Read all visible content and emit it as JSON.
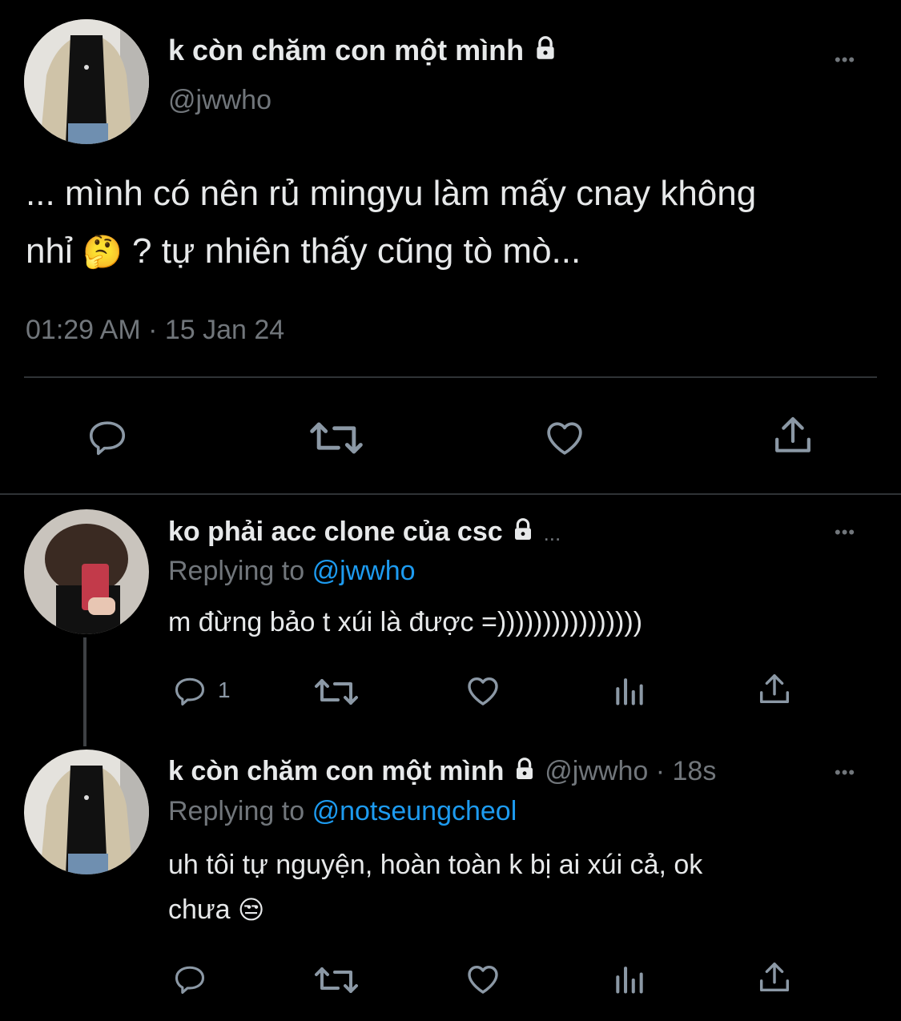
{
  "main_tweet": {
    "display_name": "k còn chăm con một mình",
    "handle": "@jwwho",
    "text_line1": "... mình có nên rủ mingyu làm mấy cnay không",
    "text_line2_a": "nhỉ",
    "text_line2_emoji": "🤔",
    "text_line2_b": "? tự nhiên thấy cũng tò mò...",
    "timestamp": "01:29 AM · 15 Jan 24",
    "icons": [
      "reply-icon",
      "retweet-icon",
      "like-icon",
      "share-icon"
    ]
  },
  "reply1": {
    "display_name": "ko phải acc clone của csc",
    "name_ellipsis": "...",
    "replying_prefix": "Replying to",
    "replying_handle": "@jwwho",
    "text": "m đừng bảo t xúi là được =))))))))))))))))",
    "reply_count": "1"
  },
  "reply2": {
    "display_name": "k còn chăm con một mình",
    "handle_time": "@jwwho · 18s",
    "replying_prefix": "Replying to",
    "replying_handle": "@notseungcheol",
    "text_line1": "uh tôi tự nguyện, hoàn toàn k bị ai xúi cả, ok",
    "text_line2": "chưa",
    "text_emoji": "😒"
  },
  "more_label": "•••",
  "colors": {
    "background": "#000000",
    "text": "#e7e9ea",
    "muted": "#71767b",
    "link": "#1d9bf0",
    "icon": "#8b98a5"
  }
}
